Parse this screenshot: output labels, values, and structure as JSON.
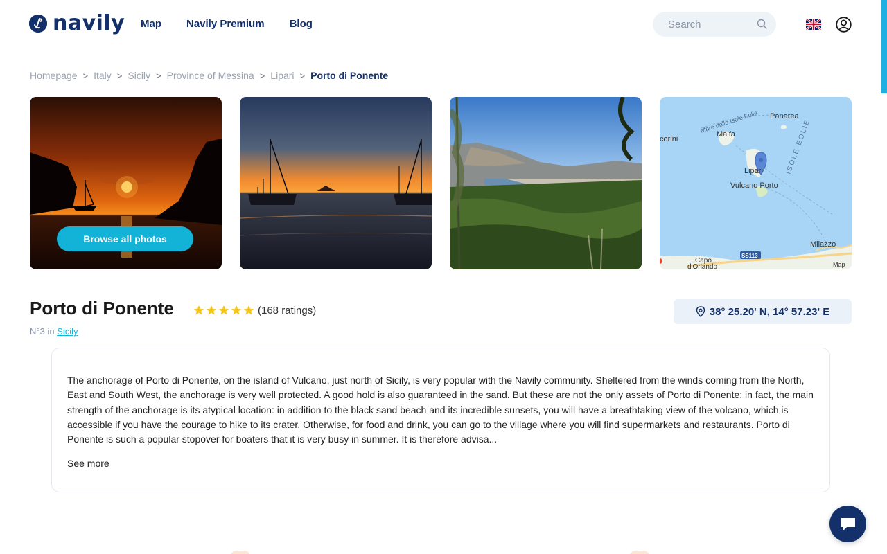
{
  "brand": {
    "name": "navily",
    "logo_icon": "anchor-icon",
    "color": "#13306b",
    "accent": "#13b3d8"
  },
  "nav": {
    "items": [
      {
        "label": "Map"
      },
      {
        "label": "Navily Premium"
      },
      {
        "label": "Blog"
      }
    ]
  },
  "search": {
    "placeholder": "Search",
    "icon": "search-icon"
  },
  "header_icons": {
    "language": "uk-flag-icon",
    "account": "user-icon"
  },
  "breadcrumb": {
    "items": [
      "Homepage",
      "Italy",
      "Sicily",
      "Province of Messina",
      "Lipari"
    ],
    "separator": ">",
    "current": "Porto di Ponente"
  },
  "gallery": {
    "browse_label": "Browse all photos",
    "photos": [
      "sunset-cliffs-photo",
      "sunset-sailboats-photo",
      "vulcano-village-photo",
      "location-map"
    ],
    "map_labels": {
      "sea": "Mare delle Isole Eolie",
      "islands": "ISOLE EOLIE",
      "panarea": "Panarea",
      "malfa": "Malfa",
      "coast_left": "corini",
      "lipari": "Lipari",
      "vulcano_porto": "Vulcano Porto",
      "milazzo": "Milazzo",
      "capo": "Capo",
      "dorlando": "d'Orlando",
      "road": "SS113",
      "attribution": "Map"
    }
  },
  "place": {
    "title": "Porto di Ponente",
    "rating_stars": 5,
    "ratings_text": "(168 ratings)",
    "rank_prefix": "N°3 in",
    "rank_link": "Sicily",
    "coordinates": "38° 25.20' N, 14° 57.23' E",
    "coordinates_icon": "location-pin-icon"
  },
  "description": {
    "text": "The anchorage of Porto di Ponente, on the island of Vulcano, just north of Sicily, is very popular with the Navily community. Sheltered from the winds coming from the North, East and South West, the anchorage is very well protected. A good hold is also guaranteed in the sand. But these are not the only assets of Porto di Ponente: in fact, the main strength of the anchorage is its atypical location: in addition to the black sand beach and its incredible sunsets, you will have a breathtaking view of the volcano, which is accessible if you have the courage to hike to its crater. Otherwise, for food and drink, you can go to the village where you will find supermarkets and restaurants. Porto di Ponente is such a popular stopover for boaters that it is very busy in summer. It is therefore advisa...",
    "see_more": "See more"
  },
  "chat": {
    "icon": "chat-bubble-icon"
  },
  "colors": {
    "star": "#f5c518",
    "map_water": "#a8d4f5"
  }
}
